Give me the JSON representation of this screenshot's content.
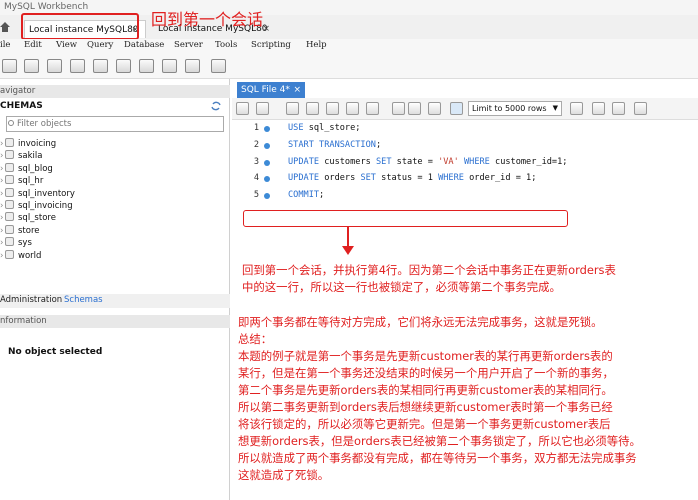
{
  "window": {
    "title": "MySQL Workbench"
  },
  "connection_tabs": [
    {
      "label": "Local instance MySQL80",
      "close": "×",
      "active": true
    },
    {
      "label": "Local instance MySQL80",
      "close": "×",
      "active": false
    }
  ],
  "annotation_top": "回到第一个会话",
  "menu": [
    "ile",
    "Edit",
    "View",
    "Query",
    "Database",
    "Server",
    "Tools",
    "Scripting",
    "Help"
  ],
  "navigator": {
    "header": "avigator",
    "schemas_title": "CHEMAS",
    "filter_placeholder": "Filter objects",
    "schemas": [
      "invoicing",
      "sakila",
      "sql_blog",
      "sql_hr",
      "sql_inventory",
      "sql_invoicing",
      "sql_store",
      "store",
      "sys",
      "world"
    ],
    "bottom_tabs": [
      "Administration",
      "Schemas"
    ],
    "info_header": "nformation",
    "no_object": "No object selected"
  },
  "editor": {
    "tab_label": "SQL File 4*",
    "tab_close": "×",
    "limit_label": "Limit to 5000 rows",
    "lines": [
      {
        "num": "1",
        "parts": [
          [
            "kw",
            "USE"
          ],
          [
            "p",
            " sql_store;"
          ]
        ]
      },
      {
        "num": "2",
        "parts": [
          [
            "kw",
            "START TRANSACTION"
          ],
          [
            "p",
            ";"
          ]
        ]
      },
      {
        "num": "3",
        "parts": [
          [
            "kw",
            "UPDATE"
          ],
          [
            "p",
            " customers "
          ],
          [
            "kw",
            "SET"
          ],
          [
            "p",
            " state = "
          ],
          [
            "str",
            "'VA'"
          ],
          [
            "p",
            " "
          ],
          [
            "kw",
            "WHERE"
          ],
          [
            "p",
            " customer_id=1;"
          ]
        ]
      },
      {
        "num": "4",
        "parts": [
          [
            "kw",
            "UPDATE"
          ],
          [
            "p",
            " orders "
          ],
          [
            "kw",
            "SET"
          ],
          [
            "p",
            " status = 1 "
          ],
          [
            "kw",
            "WHERE"
          ],
          [
            "p",
            " order_id = 1;"
          ]
        ]
      },
      {
        "num": "5",
        "parts": [
          [
            "kw",
            "COMMIT"
          ],
          [
            "p",
            ";"
          ]
        ]
      }
    ]
  },
  "annotations": [
    "回到第一个会话，并执行第4行。因为第二个会话中事务正在更新orders表",
    "中的这一行，所以这一行也被锁定了，必须等第二个事务完成。",
    "即两个事务都在等待对方完成，它们将永远无法完成事务，这就是死锁。",
    "总结：",
    "本题的例子就是第一个事务是先更新customer表的某行再更新orders表的",
    "某行，但是在第一个事务还没结束的时候另一个用户开启了一个新的事务，",
    "第二个事务是先更新orders表的某相同行再更新customer表的某相同行。",
    "所以第二事务更新到orders表后想继续更新customer表时第一个事务已经",
    "将该行锁定的，所以必须等它更新完。但是第一个事务更新customer表后",
    "想更新orders表，但是orders表已经被第二个事务锁定了，所以它也必须等待。",
    "所以就造成了两个事务都没有完成，都在等待另一个事务，双方都无法完成事务",
    "这就造成了死锁。"
  ],
  "colors": {
    "annotation": "#e02020",
    "keyword": "#2a6fd0",
    "tab_active": "#3d80d0"
  }
}
